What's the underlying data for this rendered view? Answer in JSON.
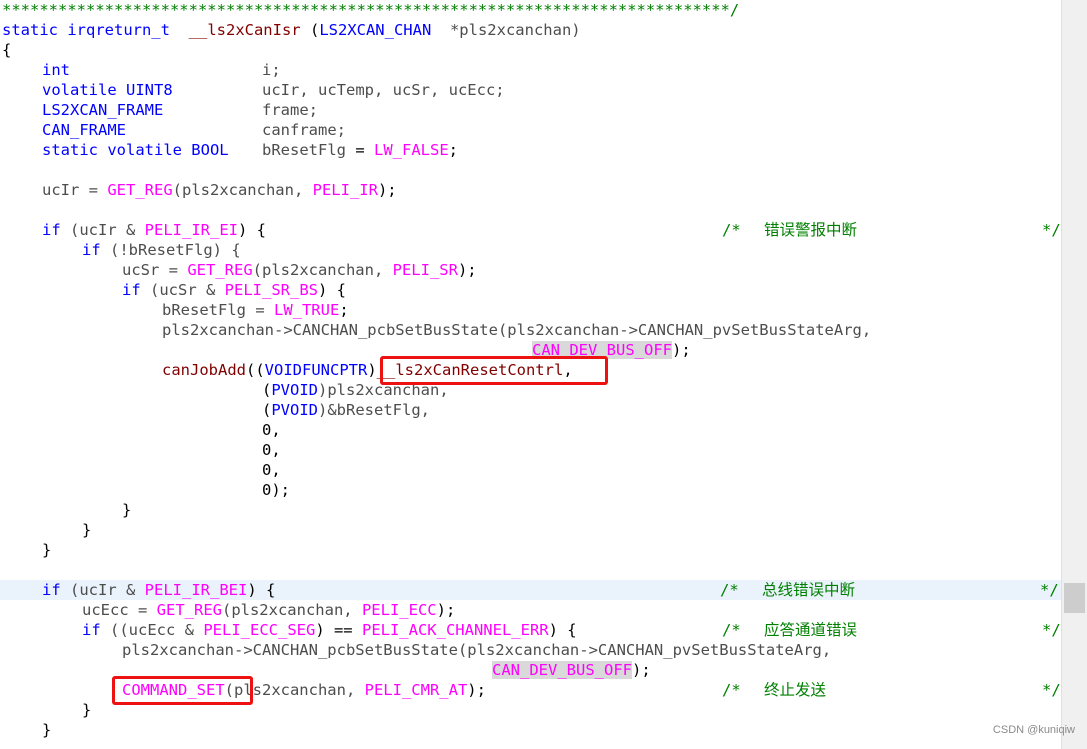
{
  "header_comment": "******************************************************************************/",
  "lines": {
    "l1": {
      "a": "static irqreturn_t",
      "b": "  ",
      "c": "__ls2xCanIsr",
      "d": " (",
      "e": "LS2XCAN_CHAN",
      "f": "  *pls2xcanchan)"
    },
    "l2": "{",
    "l3": {
      "type": "int",
      "var": "i;"
    },
    "l4": {
      "type": "volatile UINT8",
      "var": "ucIr, ucTemp, ucSr, ucEcc;"
    },
    "l5": {
      "type": "LS2XCAN_FRAME",
      "var": "frame;"
    },
    "l6": {
      "type": "CAN_FRAME",
      "var": "canframe;"
    },
    "l7": {
      "type": "static volatile BOOL",
      "var": "bResetFlg",
      "eq": " = ",
      "val": "LW_FALSE",
      "end": ";"
    },
    "l9": {
      "a": "ucIr = ",
      "b": "GET_REG",
      "c": "(pls2xcanchan, ",
      "d": "PELI_IR",
      "e": ");"
    },
    "l11": {
      "a": "if",
      "b": " (ucIr & ",
      "c": "PELI_IR_EI",
      "d": ") {",
      "comment_open": "/*",
      "comment_text": "错误警报中断",
      "comment_close": "*/"
    },
    "l12": {
      "a": "if",
      "b": " (!bResetFlg) {"
    },
    "l13": {
      "a": "ucSr = ",
      "b": "GET_REG",
      "c": "(pls2xcanchan, ",
      "d": "PELI_SR",
      "e": ");"
    },
    "l14": {
      "a": "if",
      "b": " (ucSr & ",
      "c": "PELI_SR_BS",
      "d": ") {"
    },
    "l15": {
      "a": "bResetFlg = ",
      "b": "LW_TRUE",
      "c": ";"
    },
    "l16": "pls2xcanchan->CANCHAN_pcbSetBusState(pls2xcanchan->CANCHAN_pvSetBusStateArg,",
    "l17": {
      "a": "CAN_DEV_BUS_OFF",
      "b": ");"
    },
    "l18": {
      "a": "canJobAdd",
      "b": "((",
      "c": "VOIDFUNCPTR",
      "d": ")",
      "e": "__ls2xCanResetContrl",
      "f": ","
    },
    "l19": {
      "a": "(",
      "b": "PVOID",
      "c": ")pls2xcanchan,"
    },
    "l20": {
      "a": "(",
      "b": "PVOID",
      "c": ")&bResetFlg,"
    },
    "l21": "0,",
    "l22": "0,",
    "l23": "0,",
    "l24": "0);",
    "l25": "}",
    "l26": "}",
    "l27": "}",
    "l29": {
      "a": "if",
      "b": " (ucIr & ",
      "c": "PELI_IR_BEI",
      "d": ") {",
      "comment_open": "/*",
      "comment_text": "总线错误中断",
      "comment_close": "*/"
    },
    "l30": {
      "a": "ucEcc = ",
      "b": "GET_REG",
      "c": "(pls2xcanchan, ",
      "d": "PELI_ECC",
      "e": ");"
    },
    "l31": {
      "a": "if",
      "b": " ((ucEcc & ",
      "c": "PELI_ECC_SEG",
      "d": ") == ",
      "e": "PELI_ACK_CHANNEL_ERR",
      "f": ") {",
      "comment_open": "/*",
      "comment_text": "应答通道错误",
      "comment_close": "*/"
    },
    "l32": "pls2xcanchan->CANCHAN_pcbSetBusState(pls2xcanchan->CANCHAN_pvSetBusStateArg,",
    "l33": {
      "a": "CAN_DEV_BUS_OFF",
      "b": ");"
    },
    "l34": {
      "a": "COMMAND_SET",
      "b": "(pls2xcanchan, ",
      "c": "PELI_CMR_AT",
      "d": ");",
      "comment_open": "/*",
      "comment_text": "终止发送",
      "comment_close": "*/"
    },
    "l35": "}",
    "l36": "}"
  },
  "watermark": "CSDN @kuniqiw"
}
